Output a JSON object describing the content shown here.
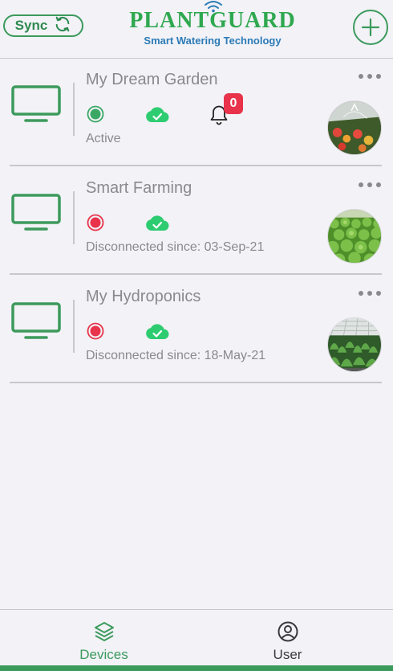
{
  "header": {
    "sync_label": "Sync",
    "brand": "PLANTGUARD",
    "tagline": "Smart Watering Technology"
  },
  "colors": {
    "accent": "#3c9a5c",
    "active": "#3aa864",
    "disconnected": "#e8334a",
    "cloud": "#2ecc71",
    "badge": "#e8334a"
  },
  "devices": [
    {
      "name": "My Dream Garden",
      "status": "active",
      "status_text": "Active",
      "has_notifications": true,
      "notification_count": "0",
      "photo": "garden-sprinkler"
    },
    {
      "name": "Smart Farming",
      "status": "disconnected",
      "status_text": "Disconnected since: 03-Sep-21",
      "has_notifications": false,
      "photo": "lettuce-field"
    },
    {
      "name": "My Hydroponics",
      "status": "disconnected",
      "status_text": "Disconnected since: 18-May-21",
      "has_notifications": false,
      "photo": "greenhouse"
    }
  ],
  "nav": {
    "devices_label": "Devices",
    "user_label": "User",
    "active": "devices"
  }
}
